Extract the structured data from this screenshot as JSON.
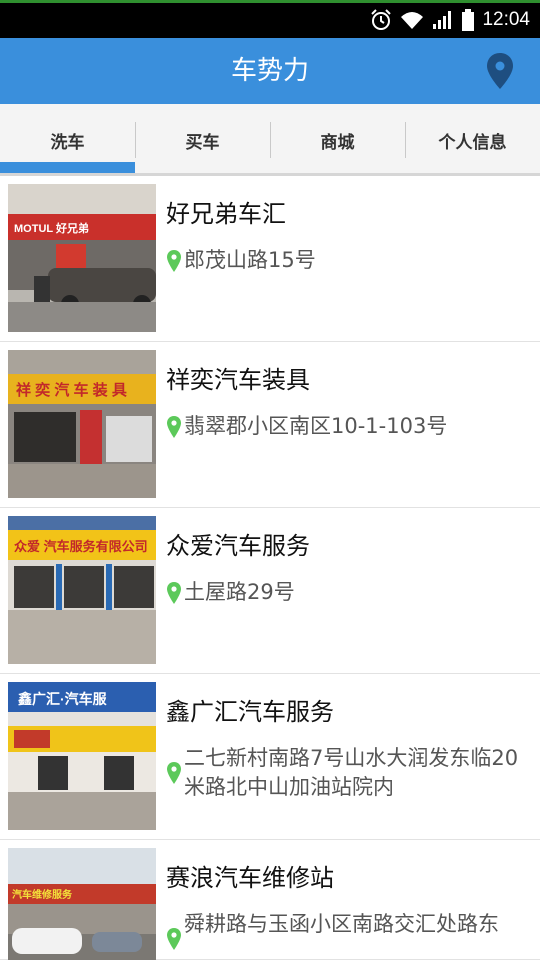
{
  "status_bar": {
    "time": "12:04",
    "icons": [
      "alarm-icon",
      "wifi-icon",
      "signal-icon",
      "battery-icon"
    ]
  },
  "header": {
    "title": "车势力",
    "location_icon": "location-pin-icon"
  },
  "tabs": [
    {
      "label": "洗车",
      "active": true
    },
    {
      "label": "买车",
      "active": false
    },
    {
      "label": "商城",
      "active": false
    },
    {
      "label": "个人信息",
      "active": false
    }
  ],
  "shops": [
    {
      "name": "好兄弟车汇",
      "address": "郎茂山路15号",
      "sign_text": "MOTUL 好兄弟"
    },
    {
      "name": "祥奕汽车装具",
      "address": "翡翠郡小区南区10-1-103号",
      "sign_text": "祥 奕 汽 车 装 具"
    },
    {
      "name": "众爱汽车服务",
      "address": "土屋路29号",
      "sign_text": "众爱 汽车服务有限公司"
    },
    {
      "name": "鑫广汇汽车服务",
      "address": "二七新村南路7号山水大润发东临20米路北中山加油站院内",
      "sign_text": "鑫广汇·汽车服"
    },
    {
      "name": "赛浪汽车维修站",
      "address": "舜耕路与玉函小区南路交汇处路东",
      "sign_text": "汽车维修服务"
    }
  ],
  "colors": {
    "header_bg": "#3a8fdc",
    "tab_indicator": "#3a8fdc",
    "pin_green": "#5cc95a"
  }
}
